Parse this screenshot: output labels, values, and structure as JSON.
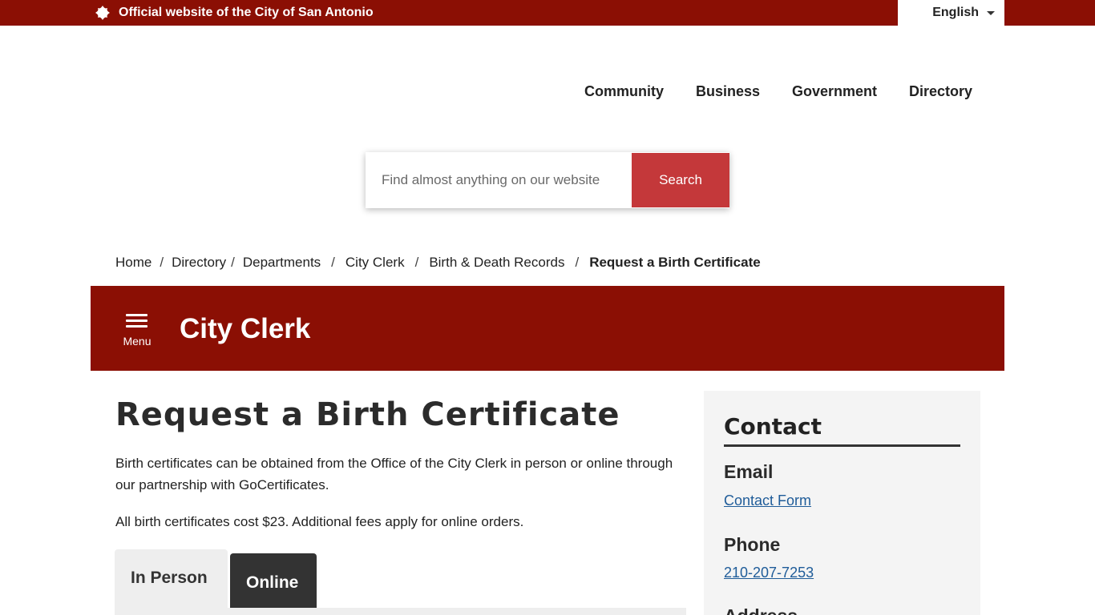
{
  "topbar": {
    "official_text": "Official website of the City of San Antonio",
    "language": "English"
  },
  "nav": {
    "items": [
      "Community",
      "Business",
      "Government",
      "Directory"
    ]
  },
  "search": {
    "placeholder": "Find almost anything on our website",
    "button_label": "Search"
  },
  "breadcrumb": {
    "items": [
      "Home",
      "Directory",
      "Departments",
      "City Clerk",
      "Birth & Death Records"
    ],
    "current": "Request a Birth Certificate",
    "separator": "/"
  },
  "department": {
    "menu_label": "Menu",
    "title": "City Clerk"
  },
  "content": {
    "title": "Request a Birth Certificate",
    "intro": "Birth certificates can be obtained from the Office of the City Clerk in person or online through our partnership with GoCertificates.",
    "fees": "All birth certificates cost $23. Additional fees apply for online orders.",
    "tabs": [
      "In Person",
      "Online"
    ]
  },
  "contact": {
    "heading": "Contact",
    "email_heading": "Email",
    "email_link": "Contact Form",
    "phone_heading": "Phone",
    "phone_link": "210-207-7253",
    "address_heading": "Address"
  },
  "colors": {
    "brand_red": "#8b0f04",
    "search_button": "#c4383a",
    "link_blue": "#1f5c99",
    "active_tab": "#333333"
  },
  "icons": {
    "seal": "city-seal-icon",
    "language_caret": "caret-down-icon",
    "menu": "hamburger-icon"
  }
}
